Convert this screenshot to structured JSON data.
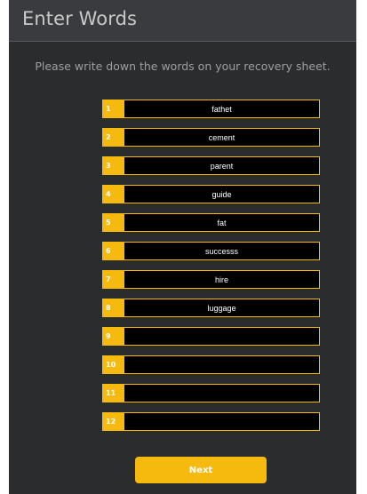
{
  "header": {
    "title": "Enter Words"
  },
  "instruction": "Please write down the words on your recovery sheet.",
  "words": [
    {
      "number": "1",
      "value": "fathet"
    },
    {
      "number": "2",
      "value": "cement"
    },
    {
      "number": "3",
      "value": "parent"
    },
    {
      "number": "4",
      "value": "guide"
    },
    {
      "number": "5",
      "value": "fat"
    },
    {
      "number": "6",
      "value": "successs"
    },
    {
      "number": "7",
      "value": "hire"
    },
    {
      "number": "8",
      "value": "luggage"
    },
    {
      "number": "9",
      "value": ""
    },
    {
      "number": "10",
      "value": ""
    },
    {
      "number": "11",
      "value": ""
    },
    {
      "number": "12",
      "value": ""
    }
  ],
  "next_button": {
    "label": "Next"
  },
  "colors": {
    "accent": "#f6b90e",
    "panel_bg": "#2b2c2e",
    "header_bg": "#3a3b3e",
    "input_bg": "#000000"
  }
}
